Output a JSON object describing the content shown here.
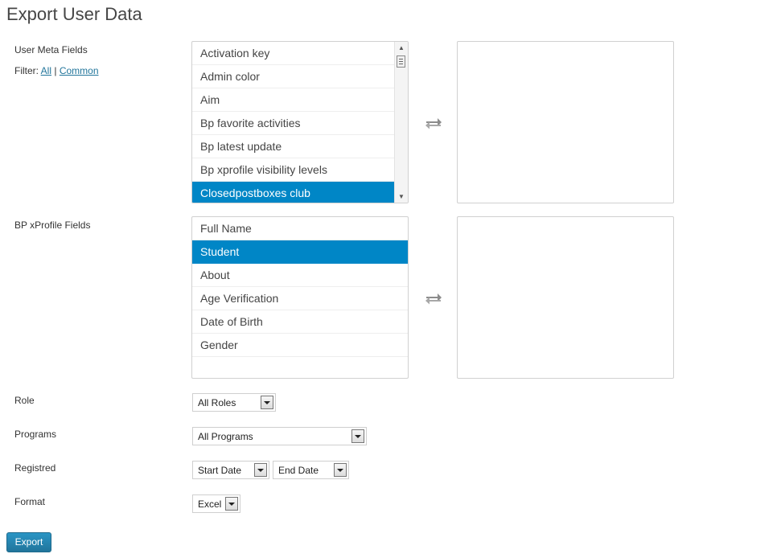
{
  "page": {
    "title": "Export User Data"
  },
  "user_meta": {
    "label": "User Meta Fields",
    "filter_label": "Filter:",
    "filter_all": "All",
    "filter_separator": "|",
    "filter_common": "Common",
    "items": [
      "Activation key",
      "Admin color",
      "Aim",
      "Bp favorite activities",
      "Bp latest update",
      "Bp xprofile visibility levels",
      "Closedpostboxes club"
    ],
    "selected_index": 6
  },
  "xprofile": {
    "label": "BP xProfile Fields",
    "items": [
      "Full Name",
      "Student",
      "About",
      "Age Verification",
      "Date of Birth",
      "Gender"
    ],
    "selected_index": 1
  },
  "role": {
    "label": "Role",
    "value": "All Roles"
  },
  "programs": {
    "label": "Programs",
    "value": "All Programs"
  },
  "registred": {
    "label": "Registred",
    "start_value": "Start Date",
    "end_value": "End Date"
  },
  "format": {
    "label": "Format",
    "value": "Excel"
  },
  "export": {
    "label": "Export"
  },
  "colors": {
    "accent": "#0086c6",
    "button": "#21759b",
    "link": "#21759b"
  },
  "icons": {
    "swap": "swap-arrows-icon",
    "dropdown": "chevron-down-icon"
  }
}
